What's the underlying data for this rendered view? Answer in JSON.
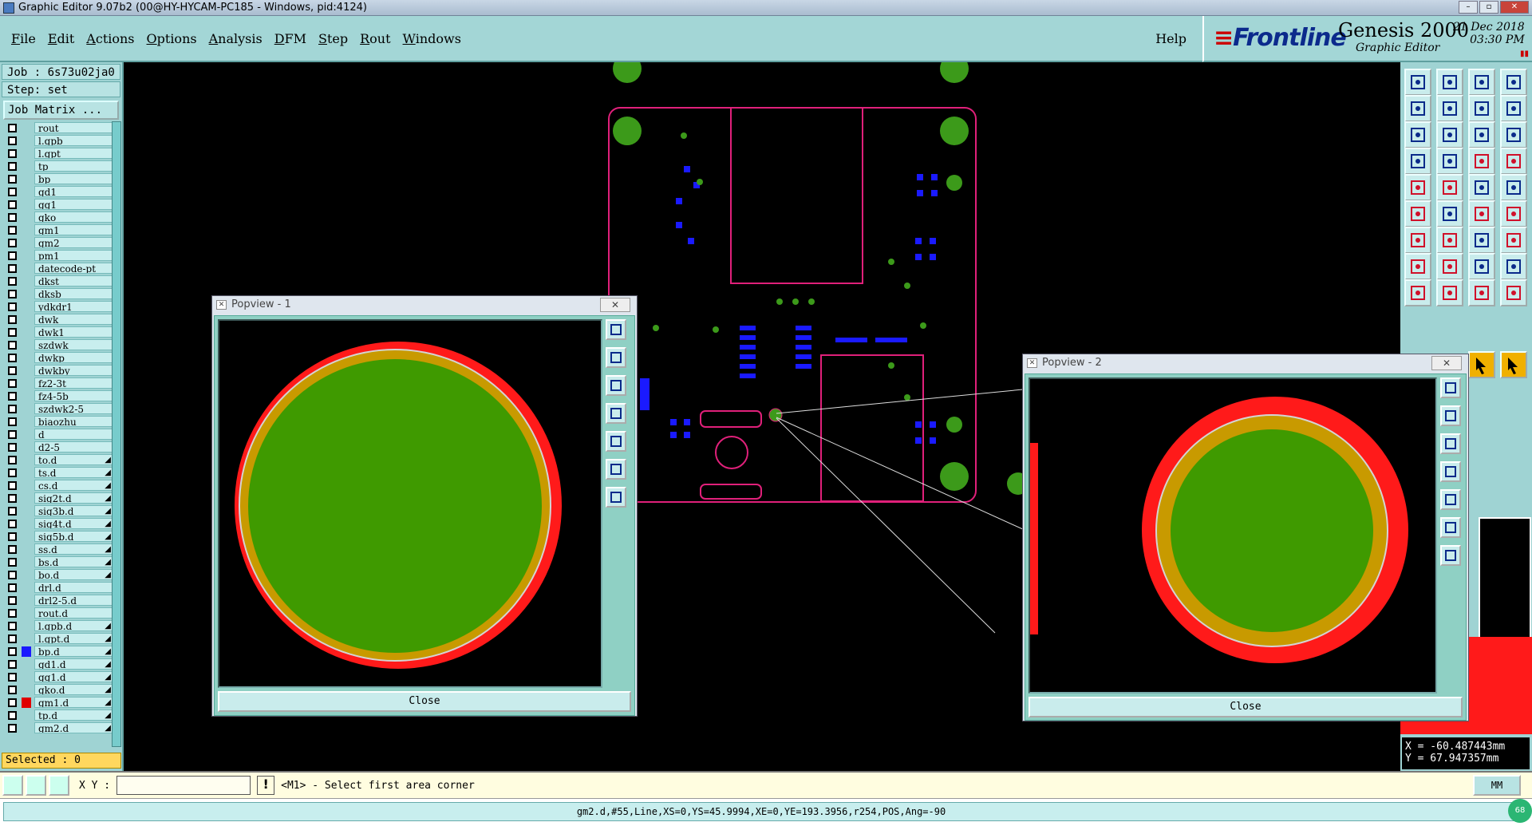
{
  "window": {
    "title": "Graphic Editor 9.07b2 (00@HY-HYCAM-PC185 - Windows, pid:4124)"
  },
  "menu": [
    "File",
    "Edit",
    "Actions",
    "Options",
    "Analysis",
    "DFM",
    "Step",
    "Rout",
    "Windows"
  ],
  "help": "Help",
  "logo": {
    "brand": "Frontline",
    "product": "Genesis 2000",
    "subtitle": "Graphic Editor",
    "date": "21 Dec 2018",
    "time": "03:30 PM"
  },
  "job": "Job : 6s73u02ja0",
  "step": "Step: set",
  "job_matrix": "Job Matrix ...",
  "layers": [
    {
      "name": "rout",
      "color": "",
      "drill": false
    },
    {
      "name": "l.gpb",
      "color": "",
      "drill": false
    },
    {
      "name": "l.gpt",
      "color": "",
      "drill": false
    },
    {
      "name": "tp",
      "color": "",
      "drill": false
    },
    {
      "name": "bp",
      "color": "",
      "drill": false
    },
    {
      "name": "gd1",
      "color": "",
      "drill": false
    },
    {
      "name": "gg1",
      "color": "",
      "drill": false
    },
    {
      "name": "gko",
      "color": "",
      "drill": false
    },
    {
      "name": "gm1",
      "color": "",
      "drill": false
    },
    {
      "name": "gm2",
      "color": "",
      "drill": false
    },
    {
      "name": "pm1",
      "color": "",
      "drill": false
    },
    {
      "name": "datecode-pt",
      "color": "",
      "drill": false
    },
    {
      "name": "dkst",
      "color": "",
      "drill": false
    },
    {
      "name": "dksb",
      "color": "",
      "drill": false
    },
    {
      "name": "ydkdr1",
      "color": "",
      "drill": false
    },
    {
      "name": "dwk",
      "color": "",
      "drill": false
    },
    {
      "name": "dwk1",
      "color": "",
      "drill": false
    },
    {
      "name": "szdwk",
      "color": "",
      "drill": false
    },
    {
      "name": "dwkp",
      "color": "",
      "drill": false
    },
    {
      "name": "dwkby",
      "color": "",
      "drill": false
    },
    {
      "name": "fz2-3t",
      "color": "",
      "drill": false
    },
    {
      "name": "fz4-5b",
      "color": "",
      "drill": false
    },
    {
      "name": "szdwk2-5",
      "color": "",
      "drill": false
    },
    {
      "name": "biaozhu",
      "color": "",
      "drill": false
    },
    {
      "name": "d",
      "color": "",
      "drill": false
    },
    {
      "name": "d2-5",
      "color": "",
      "drill": false
    },
    {
      "name": "to.d",
      "color": "",
      "drill": true
    },
    {
      "name": "ts.d",
      "color": "",
      "drill": true
    },
    {
      "name": "cs.d",
      "color": "",
      "drill": true
    },
    {
      "name": "sig2t.d",
      "color": "",
      "drill": true
    },
    {
      "name": "sig3b.d",
      "color": "",
      "drill": true
    },
    {
      "name": "sig4t.d",
      "color": "",
      "drill": true
    },
    {
      "name": "sig5b.d",
      "color": "",
      "drill": true
    },
    {
      "name": "ss.d",
      "color": "",
      "drill": true
    },
    {
      "name": "bs.d",
      "color": "",
      "drill": true
    },
    {
      "name": "bo.d",
      "color": "",
      "drill": true
    },
    {
      "name": "drl.d",
      "color": "",
      "drill": false
    },
    {
      "name": "drl2-5.d",
      "color": "",
      "drill": false
    },
    {
      "name": "rout.d",
      "color": "",
      "drill": false
    },
    {
      "name": "l.gpb.d",
      "color": "",
      "drill": true
    },
    {
      "name": "l.gpt.d",
      "color": "",
      "drill": true
    },
    {
      "name": "bp.d",
      "color": "#1a1aff",
      "drill": true
    },
    {
      "name": "gd1.d",
      "color": "",
      "drill": true
    },
    {
      "name": "gg1.d",
      "color": "",
      "drill": true
    },
    {
      "name": "gko.d",
      "color": "",
      "drill": true
    },
    {
      "name": "gm1.d",
      "color": "#e00000",
      "drill": true
    },
    {
      "name": "tp.d",
      "color": "",
      "drill": true
    },
    {
      "name": "gm2.d",
      "color": "",
      "drill": true
    }
  ],
  "selected": "Selected : 0",
  "popview1": {
    "title": "Popview - 1",
    "close": "Close"
  },
  "popview2": {
    "title": "Popview - 2",
    "close": "Close"
  },
  "xy_label": "X Y :",
  "xy_value": "",
  "prompt": "<M1> - Select first area corner",
  "units": "MM",
  "coords": {
    "x": "X = -60.487443mm",
    "y": "Y = 67.947357mm"
  },
  "status": "gm2.d,#55,Line,XS=0,YS=45.9994,XE=0,YE=193.3956,r254,POS,Ang=-90",
  "badge": "68"
}
